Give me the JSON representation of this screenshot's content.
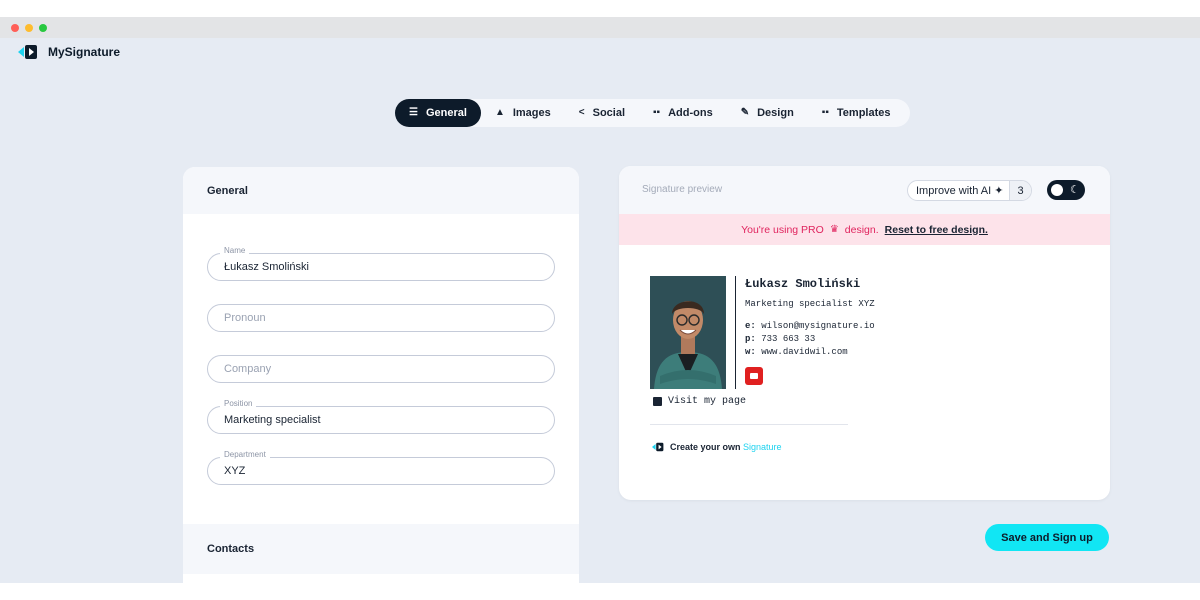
{
  "app": {
    "name": "MySignature"
  },
  "colors": {
    "accent": "#11e6f4",
    "dark": "#0d1b2a",
    "pro_bg": "#fde3ea",
    "pro_text": "#e0245e"
  },
  "tabs": [
    {
      "label": "General",
      "icon": "list-icon",
      "active": true
    },
    {
      "label": "Images",
      "icon": "image-icon",
      "active": false
    },
    {
      "label": "Social",
      "icon": "share-icon",
      "active": false
    },
    {
      "label": "Add-ons",
      "icon": "grid-icon",
      "active": false
    },
    {
      "label": "Design",
      "icon": "brush-icon",
      "active": false
    },
    {
      "label": "Templates",
      "icon": "templates-icon",
      "active": false
    }
  ],
  "form": {
    "section_title": "General",
    "fields": {
      "name": {
        "label": "Name",
        "value": "Łukasz Smoliński"
      },
      "pronoun": {
        "placeholder": "Pronoun"
      },
      "company": {
        "placeholder": "Company"
      },
      "position": {
        "label": "Position",
        "value": "Marketing specialist"
      },
      "department": {
        "label": "Department",
        "value": "XYZ"
      }
    },
    "contacts_title": "Contacts"
  },
  "preview": {
    "title": "Signature preview",
    "ai_button": "Improve with AI",
    "ai_count": "3",
    "pro_notice": "You're using PRO",
    "pro_notice_2": "design.",
    "reset_link": "Reset to free design.",
    "signature": {
      "name": "Łukasz Smoliński",
      "role": "Marketing specialist XYZ",
      "email_prefix": "e:",
      "email": "wilson@mysignature.io",
      "phone_prefix": "p:",
      "phone": "733 663 33",
      "web_prefix": "w:",
      "web": "www.davidwil.com",
      "visit": "Visit my page"
    },
    "create_text": "Create your own",
    "create_accent": "Signature"
  },
  "actions": {
    "save": "Save and Sign up"
  }
}
